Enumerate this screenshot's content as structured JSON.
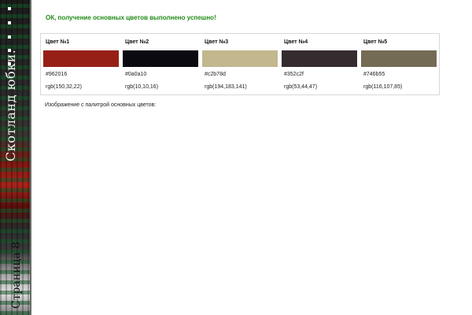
{
  "sidebar": {
    "title": "Скотланд юбки.",
    "page_label": "Страница 8"
  },
  "message": {
    "success": "ОК, получение основных цветов выполнено успешно!",
    "color": "#1f8a14"
  },
  "palette": {
    "colors": [
      {
        "label": "Цвет №1",
        "hex": "#962016",
        "rgb": "rgb(150,32,22)"
      },
      {
        "label": "Цвет №2",
        "hex": "#0a0a10",
        "rgb": "rgb(10,10,16)"
      },
      {
        "label": "Цвет №3",
        "hex": "#c2b78d",
        "rgb": "rgb(194,183,141)"
      },
      {
        "label": "Цвет №4",
        "hex": "#352c2f",
        "rgb": "rgb(53,44,47)"
      },
      {
        "label": "Цвет №5",
        "hex": "#746b55",
        "rgb": "rgb(116,107,85)"
      }
    ]
  },
  "image_section": {
    "caption": "Изображение с палитрой основных цветов:"
  }
}
